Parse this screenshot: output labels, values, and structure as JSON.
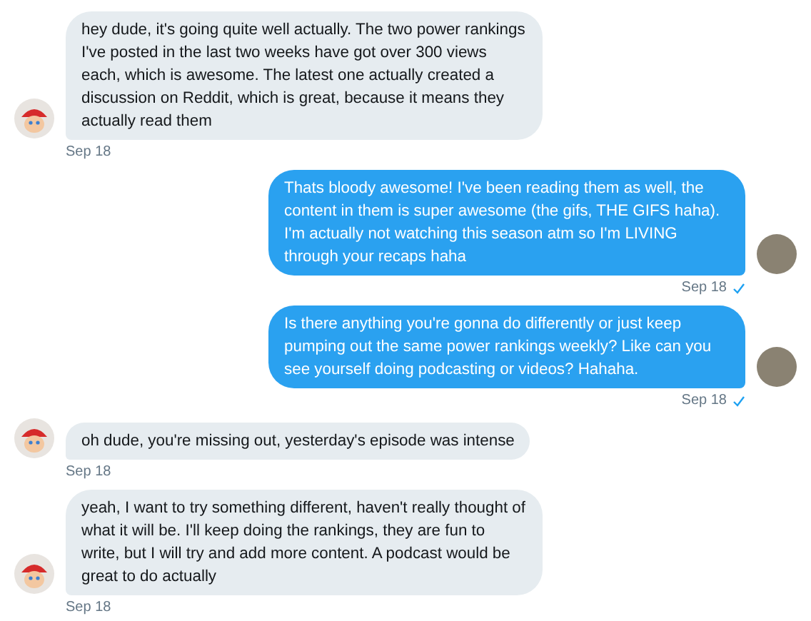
{
  "messages": [
    {
      "kind": "received",
      "text": "hey dude, it's going quite well actually. The two power rankings I've posted in the last two weeks have got over 300 views each, which is awesome. The latest one actually created a discussion on Reddit, which is great, because it means they actually read them",
      "time": "Sep 18",
      "read": false
    },
    {
      "kind": "sent",
      "text": "Thats bloody awesome! I've been reading them as well, the content in them is super awesome (the gifs, THE GIFS haha). I'm actually not watching this season atm so I'm LIVING through your recaps haha",
      "time": "Sep 18",
      "read": true
    },
    {
      "kind": "sent",
      "text": "Is there anything you're gonna do differently or just keep pumping out the same power rankings weekly? Like can you see yourself doing podcasting or videos? Hahaha.",
      "time": "Sep 18",
      "read": true
    },
    {
      "kind": "received",
      "text": "oh dude, you're missing out, yesterday's episode was intense",
      "time": "Sep 18",
      "read": false
    },
    {
      "kind": "received",
      "text": "yeah, I want to try something different, haven't really thought of what it will be. I'll keep doing the rankings, they are fun to write, but I will try and add more content. A podcast would be great to do actually",
      "time": "Sep 18",
      "read": false
    }
  ]
}
